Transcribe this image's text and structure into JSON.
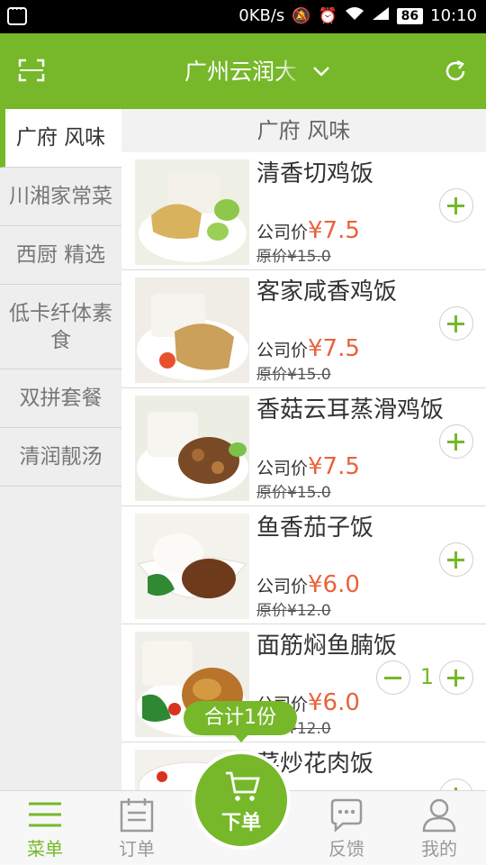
{
  "status_bar": {
    "speed": "0KB/s",
    "battery": "86",
    "time": "10:10",
    "icons": [
      "notification-icon",
      "mute-icon",
      "alarm-icon",
      "wifi-icon",
      "signal-icon",
      "battery-icon"
    ]
  },
  "header": {
    "city": "广州云润大",
    "left_icon": "scan-icon",
    "right_icon": "refresh-icon"
  },
  "categories": [
    {
      "label": "广府 风味",
      "active": true
    },
    {
      "label": "川湘家常菜",
      "active": false
    },
    {
      "label": "西厨 精选",
      "active": false
    },
    {
      "label": "低卡纤体素食",
      "active": false
    },
    {
      "label": "双拼套餐",
      "active": false
    },
    {
      "label": "清润靓汤",
      "active": false
    }
  ],
  "section_title": "广府 风味",
  "price_label": "公司价",
  "dishes": [
    {
      "name": "清香切鸡饭",
      "price": "¥7.5",
      "original": "原价¥15.0",
      "qty": 0
    },
    {
      "name": "客家咸香鸡饭",
      "price": "¥7.5",
      "original": "原价¥15.0",
      "qty": 0
    },
    {
      "name": "香菇云耳蒸滑鸡饭",
      "price": "¥7.5",
      "original": "原价¥15.0",
      "qty": 0
    },
    {
      "name": "鱼香茄子饭",
      "price": "¥6.0",
      "original": "原价¥12.0",
      "qty": 0
    },
    {
      "name": "面筋焖鱼腩饭",
      "price": "¥6.0",
      "original": "原价¥12.0",
      "qty": 1
    },
    {
      "name": "菜炒花肉饭",
      "price": "",
      "original": "",
      "qty": 0
    }
  ],
  "cart": {
    "total": "合计1份",
    "button": "下单"
  },
  "bottom_nav": [
    {
      "label": "菜单",
      "icon": "menu-icon",
      "active": true
    },
    {
      "label": "订单",
      "icon": "orders-icon",
      "active": false
    },
    {
      "label": "反馈",
      "icon": "feedback-icon",
      "active": false
    },
    {
      "label": "我的",
      "icon": "profile-icon",
      "active": false
    }
  ],
  "colors": {
    "accent": "#76b82a",
    "price": "#e8633a"
  }
}
